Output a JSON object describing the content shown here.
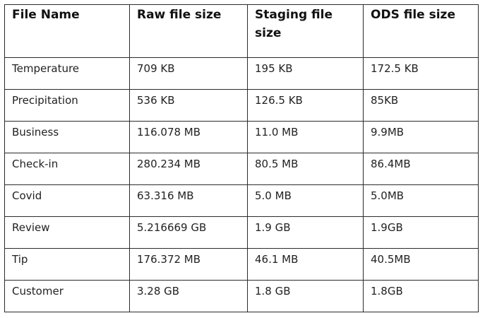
{
  "table": {
    "headers": [
      "File Name",
      "Raw file size",
      "Staging file size",
      "ODS file size"
    ],
    "rows": [
      [
        "Temperature",
        "709 KB",
        "195 KB",
        "172.5 KB"
      ],
      [
        "Precipitation",
        "536 KB",
        "126.5 KB",
        "85KB"
      ],
      [
        "Business",
        "116.078 MB",
        "11.0 MB",
        "9.9MB"
      ],
      [
        "Check-in",
        "280.234 MB",
        "80.5 MB",
        "86.4MB"
      ],
      [
        "Covid",
        "63.316 MB",
        "5.0 MB",
        "5.0MB"
      ],
      [
        "Review",
        "5.216669 GB",
        "1.9 GB",
        "1.9GB"
      ],
      [
        "Tip",
        "176.372 MB",
        "46.1 MB",
        "40.5MB"
      ],
      [
        "Customer",
        "3.28 GB",
        "1.8 GB",
        "1.8GB"
      ]
    ]
  }
}
